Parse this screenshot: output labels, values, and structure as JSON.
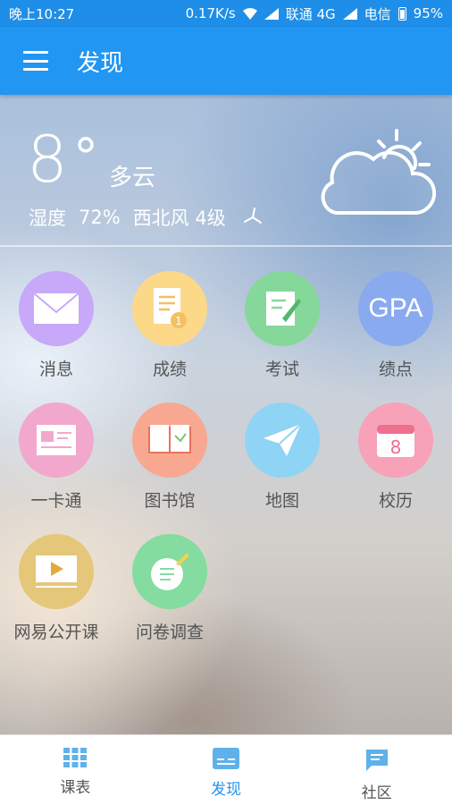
{
  "status": {
    "time": "晚上10:27",
    "speed": "0.17K/s",
    "carrier1": "联通 4G",
    "carrier2": "电信",
    "battery": "95%"
  },
  "appbar": {
    "title": "发现"
  },
  "weather": {
    "temp": "8",
    "degree": "°",
    "condition": "多云",
    "humidity_label": "湿度",
    "humidity": "72%",
    "wind": "西北风 4级"
  },
  "apps": [
    {
      "label": "消息",
      "color": "#c8a8f8",
      "icon": "envelope-icon"
    },
    {
      "label": "成绩",
      "color": "#fcd889",
      "icon": "report-icon"
    },
    {
      "label": "考试",
      "color": "#86d89a",
      "icon": "exam-icon"
    },
    {
      "label": "绩点",
      "color": "#8aaaf0",
      "icon": "gpa-icon",
      "text": "GPA"
    },
    {
      "label": "一卡通",
      "color": "#f2a8cc",
      "icon": "card-icon"
    },
    {
      "label": "图书馆",
      "color": "#f8a891",
      "icon": "book-icon"
    },
    {
      "label": "地图",
      "color": "#8fd4f4",
      "icon": "paper-plane-icon"
    },
    {
      "label": "校历",
      "color": "#f7a2b8",
      "icon": "calendar-icon",
      "text": "8"
    },
    {
      "label": "网易公开课",
      "color": "#e4c779",
      "icon": "video-icon"
    },
    {
      "label": "问卷调查",
      "color": "#84dca0",
      "icon": "notebook-icon"
    }
  ],
  "tabs": [
    {
      "label": "课表",
      "icon": "grid-icon"
    },
    {
      "label": "发现",
      "icon": "discover-icon"
    },
    {
      "label": "社区",
      "icon": "chat-icon"
    }
  ],
  "colors": {
    "primary": "#2196f3",
    "tab_inactive": "#5fb1e9"
  }
}
